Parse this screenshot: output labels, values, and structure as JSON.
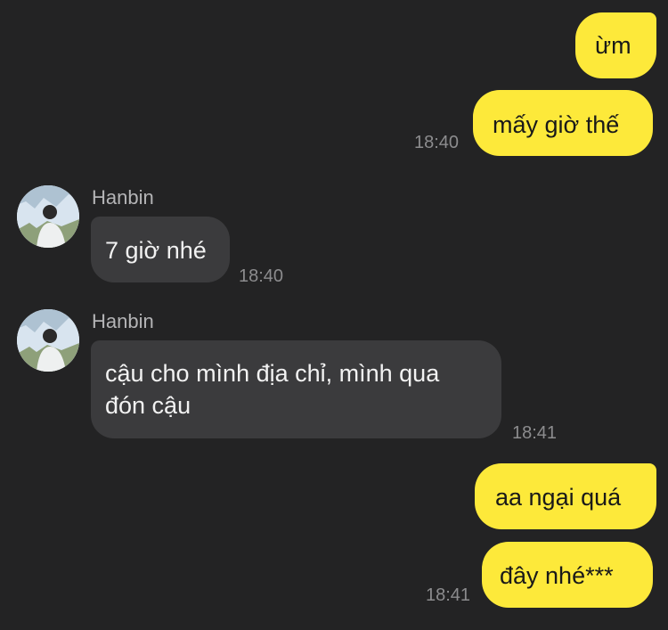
{
  "messages": [
    {
      "type": "outgoing",
      "text": "ừm"
    },
    {
      "type": "outgoing",
      "text": "mấy giờ thế",
      "time": "18:40"
    },
    {
      "type": "incoming",
      "sender": "Hanbin",
      "text": "7 giờ nhé",
      "time": "18:40"
    },
    {
      "type": "incoming",
      "sender": "Hanbin",
      "text": "cậu cho mình địa chỉ, mình qua đón cậu",
      "time": "18:41"
    },
    {
      "type": "outgoing",
      "text": "aa ngại quá"
    },
    {
      "type": "outgoing",
      "text": "đây nhé***",
      "time": "18:41"
    }
  ],
  "colors": {
    "background": "#232324",
    "outgoing_bubble": "#fde93a",
    "incoming_bubble": "#3b3b3d",
    "timestamp": "#8c8c8e",
    "sender_name": "#b4b4b6"
  },
  "icons": {
    "avatar": "profile-photo-avatar"
  }
}
